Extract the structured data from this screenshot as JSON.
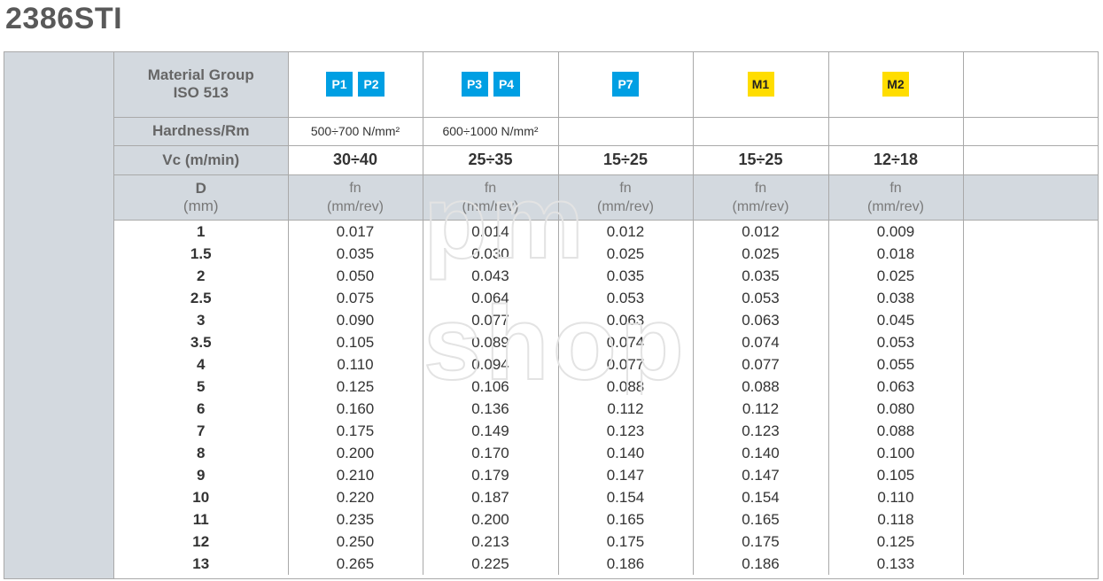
{
  "title": "2386STI",
  "header": {
    "material_label": [
      "Material Group",
      "ISO 513"
    ],
    "hardness_label": "Hardness/Rm",
    "vc_label": "Vc (m/min)",
    "d_label": [
      "D",
      "(mm)"
    ]
  },
  "columns": [
    {
      "badges": [
        {
          "text": "P1",
          "color": "#009fe3"
        },
        {
          "text": "P2",
          "color": "#009fe3"
        }
      ],
      "hardness": "500÷700 N/mm²",
      "vc": "30÷40",
      "unit": [
        "fn",
        "(mm/rev)"
      ]
    },
    {
      "badges": [
        {
          "text": "P3",
          "color": "#009fe3"
        },
        {
          "text": "P4",
          "color": "#009fe3"
        }
      ],
      "hardness": "600÷1000 N/mm²",
      "vc": "25÷35",
      "unit": [
        "fn",
        "(mm/rev)"
      ]
    },
    {
      "badges": [
        {
          "text": "P7",
          "color": "#009fe3"
        }
      ],
      "hardness": "",
      "vc": "15÷25",
      "unit": [
        "fn",
        "(mm/rev)"
      ]
    },
    {
      "badges": [
        {
          "text": "M1",
          "color": "#ffdd00"
        }
      ],
      "hardness": "",
      "vc": "15÷25",
      "unit": [
        "fn",
        "(mm/rev)"
      ]
    },
    {
      "badges": [
        {
          "text": "M2",
          "color": "#ffdd00"
        }
      ],
      "hardness": "",
      "vc": "12÷18",
      "unit": [
        "fn",
        "(mm/rev)"
      ]
    }
  ],
  "rows": [
    {
      "d": "1",
      "values": [
        "0.017",
        "0.014",
        "0.012",
        "0.012",
        "0.009"
      ]
    },
    {
      "d": "1.5",
      "values": [
        "0.035",
        "0.030",
        "0.025",
        "0.025",
        "0.018"
      ]
    },
    {
      "d": "2",
      "values": [
        "0.050",
        "0.043",
        "0.035",
        "0.035",
        "0.025"
      ]
    },
    {
      "d": "2.5",
      "values": [
        "0.075",
        "0.064",
        "0.053",
        "0.053",
        "0.038"
      ]
    },
    {
      "d": "3",
      "values": [
        "0.090",
        "0.077",
        "0.063",
        "0.063",
        "0.045"
      ]
    },
    {
      "d": "3.5",
      "values": [
        "0.105",
        "0.089",
        "0.074",
        "0.074",
        "0.053"
      ]
    },
    {
      "d": "4",
      "values": [
        "0.110",
        "0.094",
        "0.077",
        "0.077",
        "0.055"
      ]
    },
    {
      "d": "5",
      "values": [
        "0.125",
        "0.106",
        "0.088",
        "0.088",
        "0.063"
      ]
    },
    {
      "d": "6",
      "values": [
        "0.160",
        "0.136",
        "0.112",
        "0.112",
        "0.080"
      ]
    },
    {
      "d": "7",
      "values": [
        "0.175",
        "0.149",
        "0.123",
        "0.123",
        "0.088"
      ]
    },
    {
      "d": "8",
      "values": [
        "0.200",
        "0.170",
        "0.140",
        "0.140",
        "0.100"
      ]
    },
    {
      "d": "9",
      "values": [
        "0.210",
        "0.179",
        "0.147",
        "0.147",
        "0.105"
      ]
    },
    {
      "d": "10",
      "values": [
        "0.220",
        "0.187",
        "0.154",
        "0.154",
        "0.110"
      ]
    },
    {
      "d": "11",
      "values": [
        "0.235",
        "0.200",
        "0.165",
        "0.165",
        "0.118"
      ]
    },
    {
      "d": "12",
      "values": [
        "0.250",
        "0.213",
        "0.175",
        "0.175",
        "0.125"
      ]
    },
    {
      "d": "13",
      "values": [
        "0.265",
        "0.225",
        "0.186",
        "0.186",
        "0.133"
      ]
    }
  ],
  "watermark": [
    "pm",
    "shop"
  ]
}
